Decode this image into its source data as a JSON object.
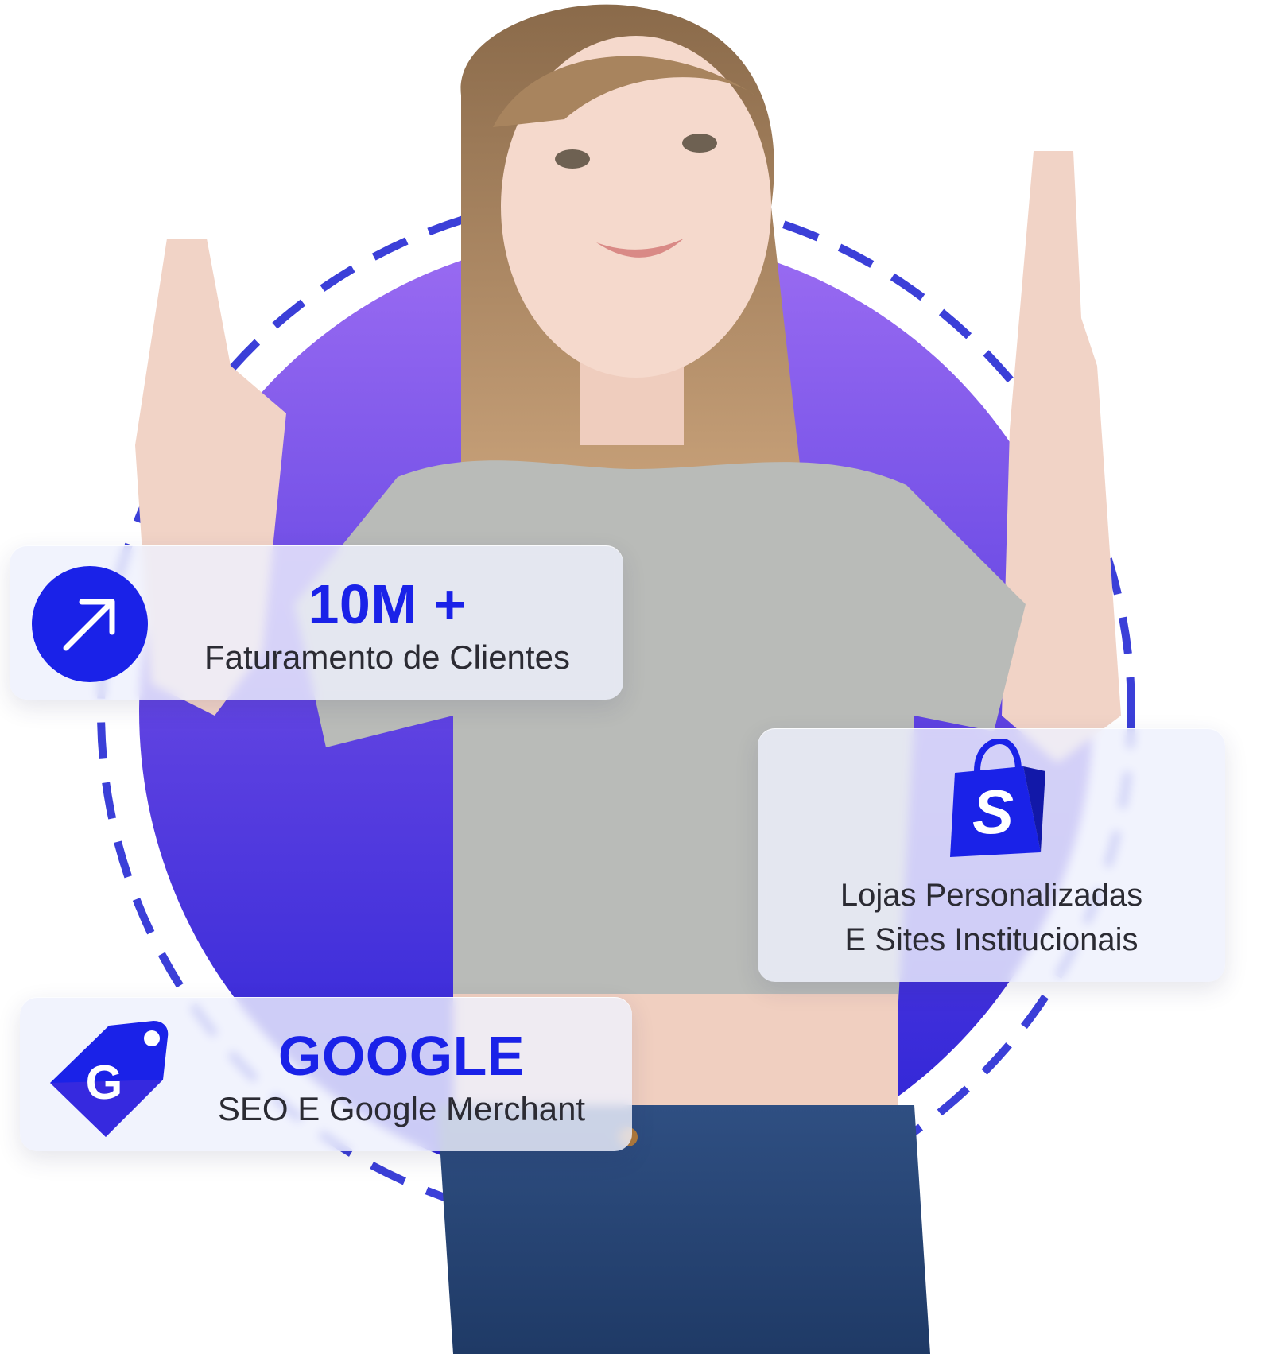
{
  "colors": {
    "brand_blue": "#1a22e8",
    "brand_purple": "#6d4fe0",
    "ring_dash": "#3b3fd8",
    "text_dark": "#2b2b33"
  },
  "cards": {
    "revenue": {
      "icon": "arrow-up-right-icon",
      "headline": "10M +",
      "subtitle": "Faturamento de Clientes"
    },
    "stores": {
      "icon": "shopify-bag-icon",
      "logo_letter": "S",
      "subtitle_line1": "Lojas Personalizadas",
      "subtitle_line2": "E Sites Institucionais"
    },
    "google": {
      "icon": "google-tag-icon",
      "logo_letter": "G",
      "headline": "GOOGLE",
      "subtitle": "SEO E Google Merchant"
    }
  }
}
